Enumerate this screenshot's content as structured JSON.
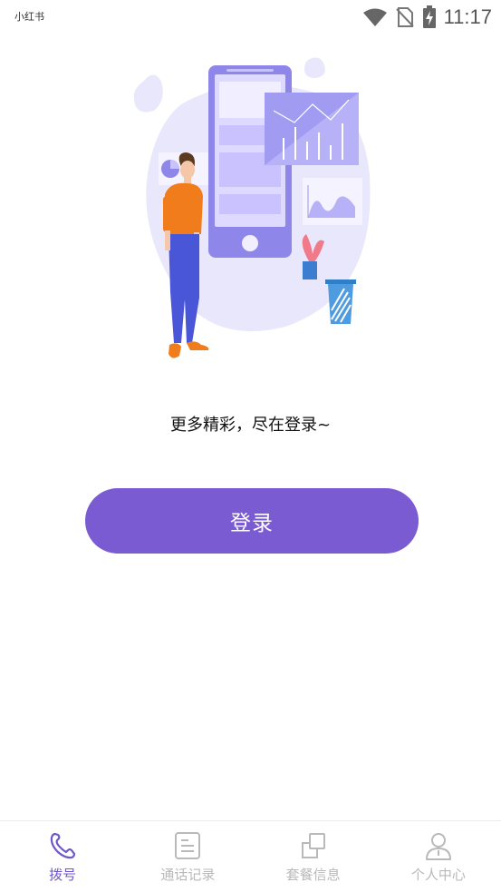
{
  "status_bar": {
    "app_name": "小红书",
    "time": "11:17",
    "icons": [
      "wifi-icon",
      "no-sim-icon",
      "battery-charging-icon"
    ]
  },
  "colors": {
    "accent": "#7b5bd1",
    "tab_active": "#6f57c8",
    "tab_inactive": "#b9b9b9"
  },
  "main": {
    "tagline": "更多精彩，尽在登录~",
    "login_label": "登录"
  },
  "tabs": [
    {
      "label": "拨号",
      "icon": "phone-icon",
      "active": true
    },
    {
      "label": "通话记录",
      "icon": "call-log-icon",
      "active": false
    },
    {
      "label": "套餐信息",
      "icon": "package-icon",
      "active": false
    },
    {
      "label": "个人中心",
      "icon": "user-icon",
      "active": false
    }
  ]
}
